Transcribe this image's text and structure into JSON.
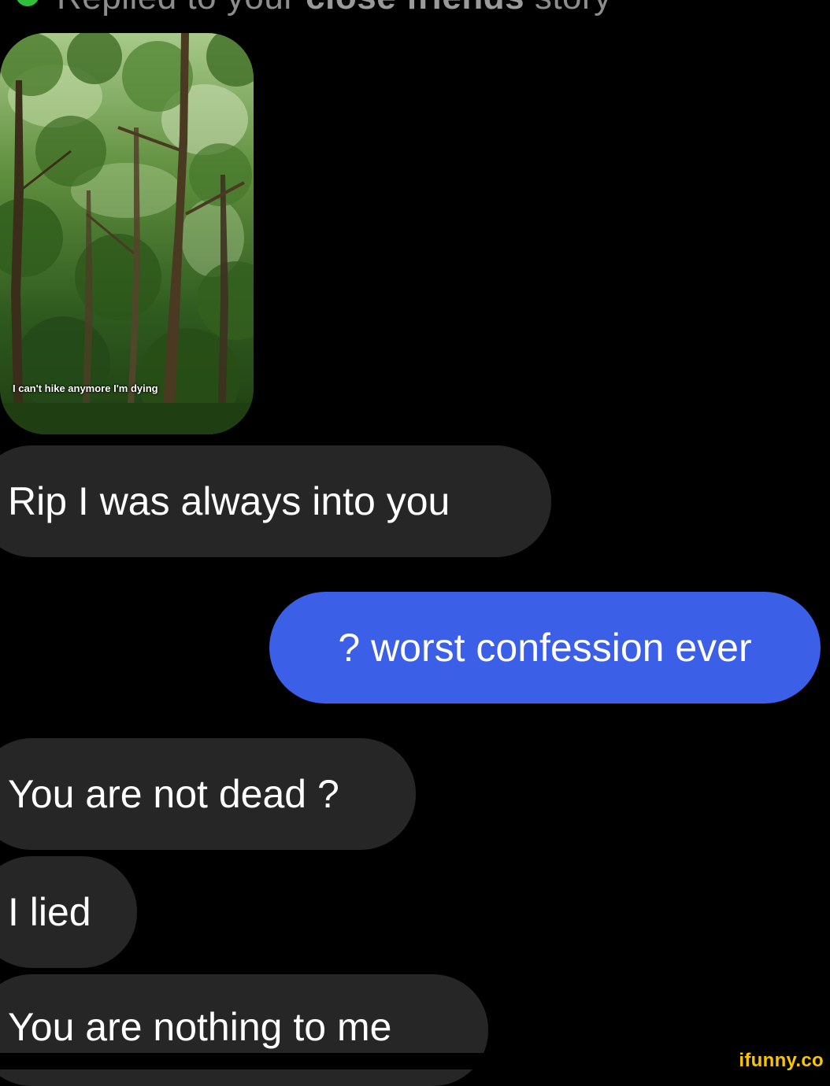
{
  "header": {
    "prefix": "Replied to your ",
    "highlight": "close friends",
    "suffix": " story",
    "badge_icon": "star-icon",
    "badge_color": "#2fbf3b"
  },
  "story": {
    "caption": "I can't hike anymore I'm dying"
  },
  "messages": [
    {
      "sender": "them",
      "text": "Rip I was always into you"
    },
    {
      "sender": "me",
      "text": "? worst confession ever"
    },
    {
      "sender": "them",
      "text": "You are not dead ?"
    },
    {
      "sender": "them",
      "text": "I lied"
    },
    {
      "sender": "them",
      "text": "You are nothing to me"
    }
  ],
  "colors": {
    "background": "#000000",
    "incoming_bubble": "#262626",
    "outgoing_bubble": "#3b5fe6",
    "watermark": "#f7c600"
  },
  "watermark": "ifunny.co"
}
